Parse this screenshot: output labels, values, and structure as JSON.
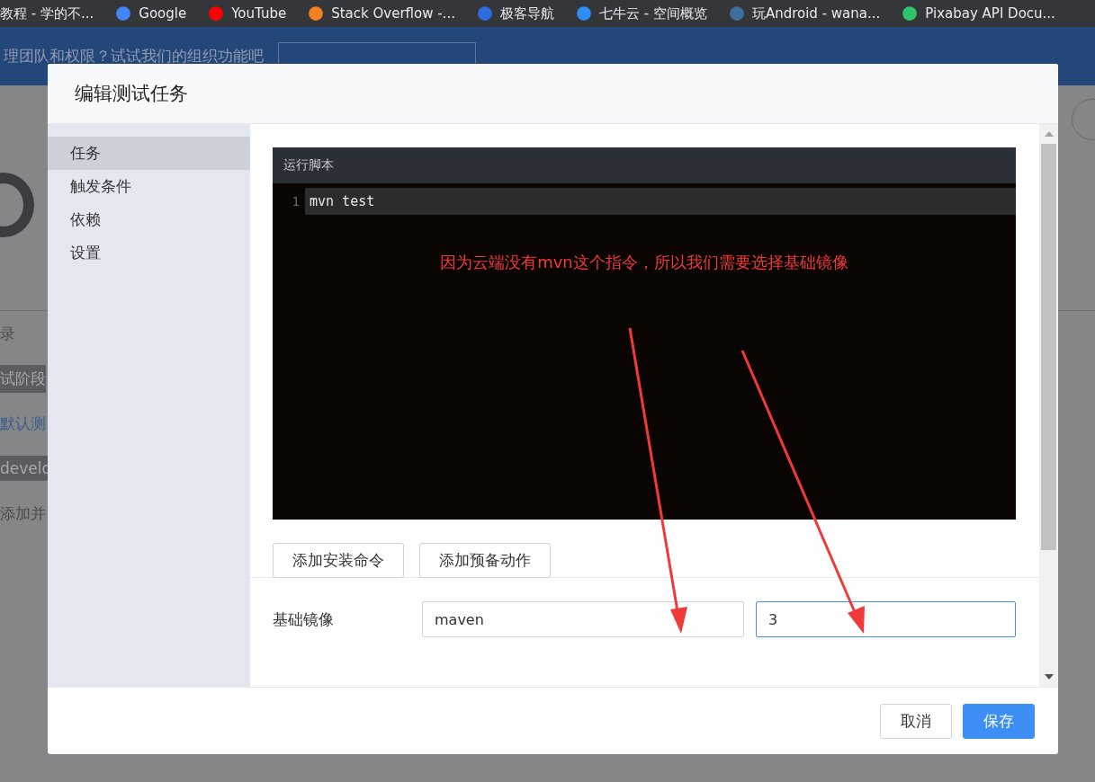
{
  "bookmarks": [
    {
      "label": "教程 - 学的不..."
    },
    {
      "label": "Google"
    },
    {
      "label": "YouTube"
    },
    {
      "label": "Stack Overflow -..."
    },
    {
      "label": "极客导航"
    },
    {
      "label": "七牛云 - 空间概览"
    },
    {
      "label": "玩Android - wana..."
    },
    {
      "label": "Pixabay API Docu..."
    }
  ],
  "background": {
    "banner_text": "理团队和权限？试试我们的组织功能吧",
    "items": [
      {
        "kind": "text",
        "label": "录"
      },
      {
        "kind": "tag",
        "label": "试阶段"
      },
      {
        "kind": "link",
        "label": "默认测"
      },
      {
        "kind": "tag",
        "label": "develo"
      },
      {
        "kind": "text",
        "label": "添加并"
      }
    ]
  },
  "dialog": {
    "title": "编辑测试任务",
    "nav": [
      {
        "label": "任务",
        "selected": true
      },
      {
        "label": "触发条件",
        "selected": false
      },
      {
        "label": "依赖",
        "selected": false
      },
      {
        "label": "设置",
        "selected": false
      }
    ],
    "script": {
      "title": "运行脚本",
      "lines": [
        {
          "number": "1",
          "text": "mvn test"
        }
      ]
    },
    "annotation": "因为云端没有mvn这个指令，所以我们需要选择基础镜像",
    "action_buttons": [
      "添加安装命令",
      "添加预备动作"
    ],
    "base_image": {
      "label": "基础镜像",
      "name": "maven",
      "tag": "3"
    },
    "footer_buttons": [
      {
        "label": "取消",
        "kind": "secondary"
      },
      {
        "label": "保存",
        "kind": "primary"
      }
    ]
  }
}
